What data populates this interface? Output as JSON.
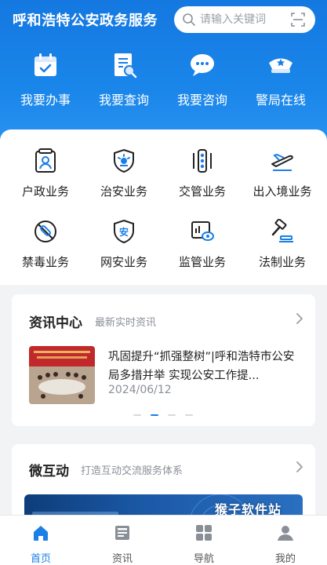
{
  "app": {
    "title": "呼和浩特公安政务服务"
  },
  "search": {
    "placeholder": "请输入关键词"
  },
  "quick_actions": [
    {
      "label": "我要办事",
      "icon": "calendar-check-icon"
    },
    {
      "label": "我要查询",
      "icon": "document-search-icon"
    },
    {
      "label": "我要咨询",
      "icon": "chat-bubbles-icon"
    },
    {
      "label": "警局在线",
      "icon": "police-cap-icon"
    }
  ],
  "services": [
    {
      "label": "户政业务",
      "icon": "id-card-icon"
    },
    {
      "label": "治安业务",
      "icon": "shield-light-icon"
    },
    {
      "label": "交管业务",
      "icon": "traffic-light-icon"
    },
    {
      "label": "出入境业务",
      "icon": "airplane-icon"
    },
    {
      "label": "禁毒业务",
      "icon": "no-drugs-icon"
    },
    {
      "label": "网安业务",
      "icon": "shield-safe-icon"
    },
    {
      "label": "监管业务",
      "icon": "monitor-eye-icon"
    },
    {
      "label": "法制业务",
      "icon": "gavel-icon"
    }
  ],
  "news": {
    "title": "资讯中心",
    "subtitle": "最新实时资讯",
    "headline": "巩固提升“抓强整树”|呼和浩特市公安局多措并举 实现公安工作提...",
    "date": "2024/06/12",
    "slide_count": 4,
    "active_slide": 2
  },
  "interaction": {
    "title": "微互动",
    "subtitle": "打造互动交流服务体系",
    "watermark": "猴子软件站"
  },
  "bottom_nav": [
    {
      "label": "首页",
      "icon": "home-icon",
      "active": true
    },
    {
      "label": "资讯",
      "icon": "news-icon",
      "active": false
    },
    {
      "label": "导航",
      "icon": "grid-icon",
      "active": false
    },
    {
      "label": "我的",
      "icon": "user-icon",
      "active": false
    }
  ],
  "colors": {
    "primary": "#1a7fe6",
    "header": "#1478e0",
    "background": "#f2f3f5"
  }
}
